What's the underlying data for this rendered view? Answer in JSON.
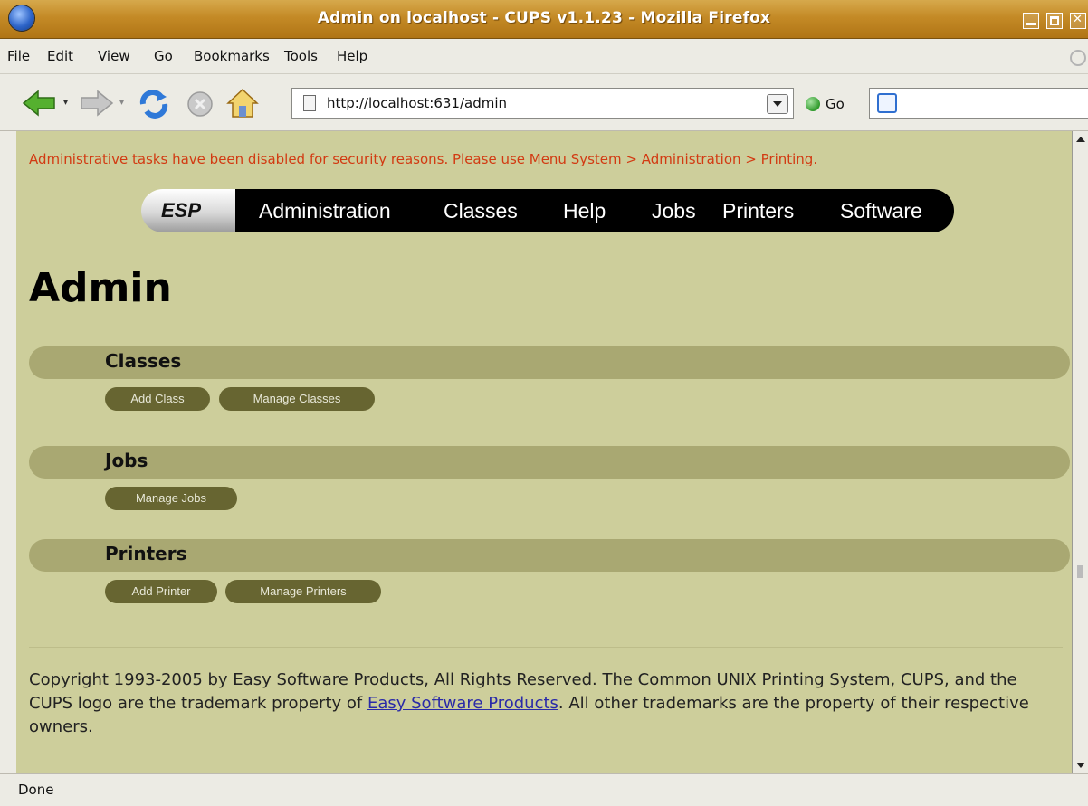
{
  "window": {
    "title": "Admin on localhost - CUPS v1.1.23 - Mozilla Firefox"
  },
  "menu": [
    {
      "label": "File"
    },
    {
      "label": "Edit"
    },
    {
      "label": "View"
    },
    {
      "label": "Go"
    },
    {
      "label": "Bookmarks"
    },
    {
      "label": "Tools"
    },
    {
      "label": "Help"
    }
  ],
  "toolbar": {
    "url": "http://localhost:631/admin",
    "go_label": "Go",
    "icons": [
      "back-arrow-icon",
      "forward-arrow-icon",
      "reload-icon",
      "stop-icon",
      "home-icon",
      "page-icon",
      "search-engine-icon"
    ]
  },
  "page": {
    "warning": "Administrative tasks have been disabled for security reasons. Please use Menu System > Administration > Printing.",
    "nav": {
      "brand": "ESP",
      "items": [
        "Administration",
        "Classes",
        "Help",
        "Jobs",
        "Printers",
        "Software"
      ]
    },
    "title": "Admin",
    "sections": [
      {
        "heading": "Classes",
        "buttons": [
          "Add Class",
          "Manage Classes"
        ]
      },
      {
        "heading": "Jobs",
        "buttons": [
          "Manage Jobs"
        ]
      },
      {
        "heading": "Printers",
        "buttons": [
          "Add Printer",
          "Manage Printers"
        ]
      }
    ],
    "footer": {
      "text_before": "Copyright 1993-2005 by Easy Software Products, All Rights Reserved. The Common UNIX Printing System, CUPS, and the CUPS logo are the trademark property of ",
      "link_text": "Easy Software Products",
      "text_after": ". All other trademarks are the property of their respective owners."
    }
  },
  "status": "Done",
  "colors": {
    "page_bg": "#cdce9b",
    "section_bar": "#a9a872",
    "button_bg": "#676531",
    "warning": "#d23a12",
    "titlebar": "#c48a26"
  }
}
